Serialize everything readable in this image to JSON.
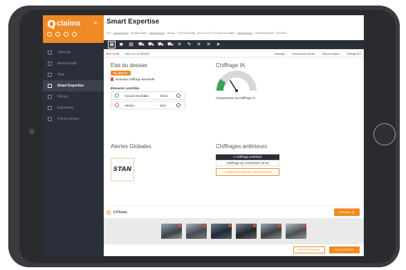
{
  "app": {
    "logo_mark": "Q",
    "logo_text": "claims",
    "page_title": "Smart Expertise"
  },
  "sidebar": {
    "items": [
      {
        "label": "Véhicule",
        "icon": "car-icon",
        "active": false
      },
      {
        "label": "Administratif",
        "icon": "document-icon",
        "active": false
      },
      {
        "label": "Taux",
        "icon": "rate-icon",
        "active": false
      },
      {
        "label": "Smart Expertise",
        "icon": "expertise-icon",
        "active": true
      },
      {
        "label": "Pièces",
        "icon": "parts-icon",
        "active": false
      },
      {
        "label": "Estimation",
        "icon": "estimate-icon",
        "active": false
      },
      {
        "label": "Pièces jointes",
        "icon": "paperclip-icon",
        "active": false
      }
    ]
  },
  "infobar": {
    "vin_label": "VIN :",
    "immat_label": "Immatriculation :",
    "brand_text": "Marque : TOYOTA  Modèle : Bm a (Icd 5) 11-20",
    "owner_label": "Nom du sinistré :",
    "ref_label": "Référence dernier : 2020/05/1..."
  },
  "subbar": {
    "date": "28/07 15:58",
    "garage": "TAVILLA G DU BEURD",
    "links": [
      "Historique",
      "Informations véhicule",
      "Grille de relation",
      "Chiffrage E/O"
    ]
  },
  "dossier": {
    "title": "Etat du dossier",
    "status_badge": "En attente",
    "new_quote": "Nouveau chiffrage demandé",
    "checks_title": "Éléments contrôlés",
    "checks": [
      {
        "label": "Aucune anomalie",
        "value": "10/12",
        "status_color": "#3aa35b"
      },
      {
        "label": "Alertes",
        "value": "0/12",
        "status_color": "#e0513a"
      }
    ]
  },
  "chiffrage_ia": {
    "title": "Chiffrage IA",
    "caption": "Comparaison au chiffrage IA",
    "level": 0.2
  },
  "alertes": {
    "title": "Alertes Globales",
    "logo_text": "STAN"
  },
  "anterieurs": {
    "title": "Chiffrages antérieurs",
    "count_label": "1 Chiffrage antérieur",
    "item": "Chiffrage du 17/04/2020 15:43",
    "compare_button": "COMPARER DEUX CHIFFRAGES"
  },
  "photos": {
    "label": "6 Photos",
    "next_button": "SUIVANT ❯",
    "thumb_count": 6
  },
  "footer": {
    "secondary_button": "ENVOYER À NOUS",
    "primary_button": "ALLER À PIÈCES"
  },
  "colors": {
    "accent": "#f08a24",
    "dark": "#2b2f3a",
    "danger": "#e0513a",
    "success": "#3aa35b"
  }
}
